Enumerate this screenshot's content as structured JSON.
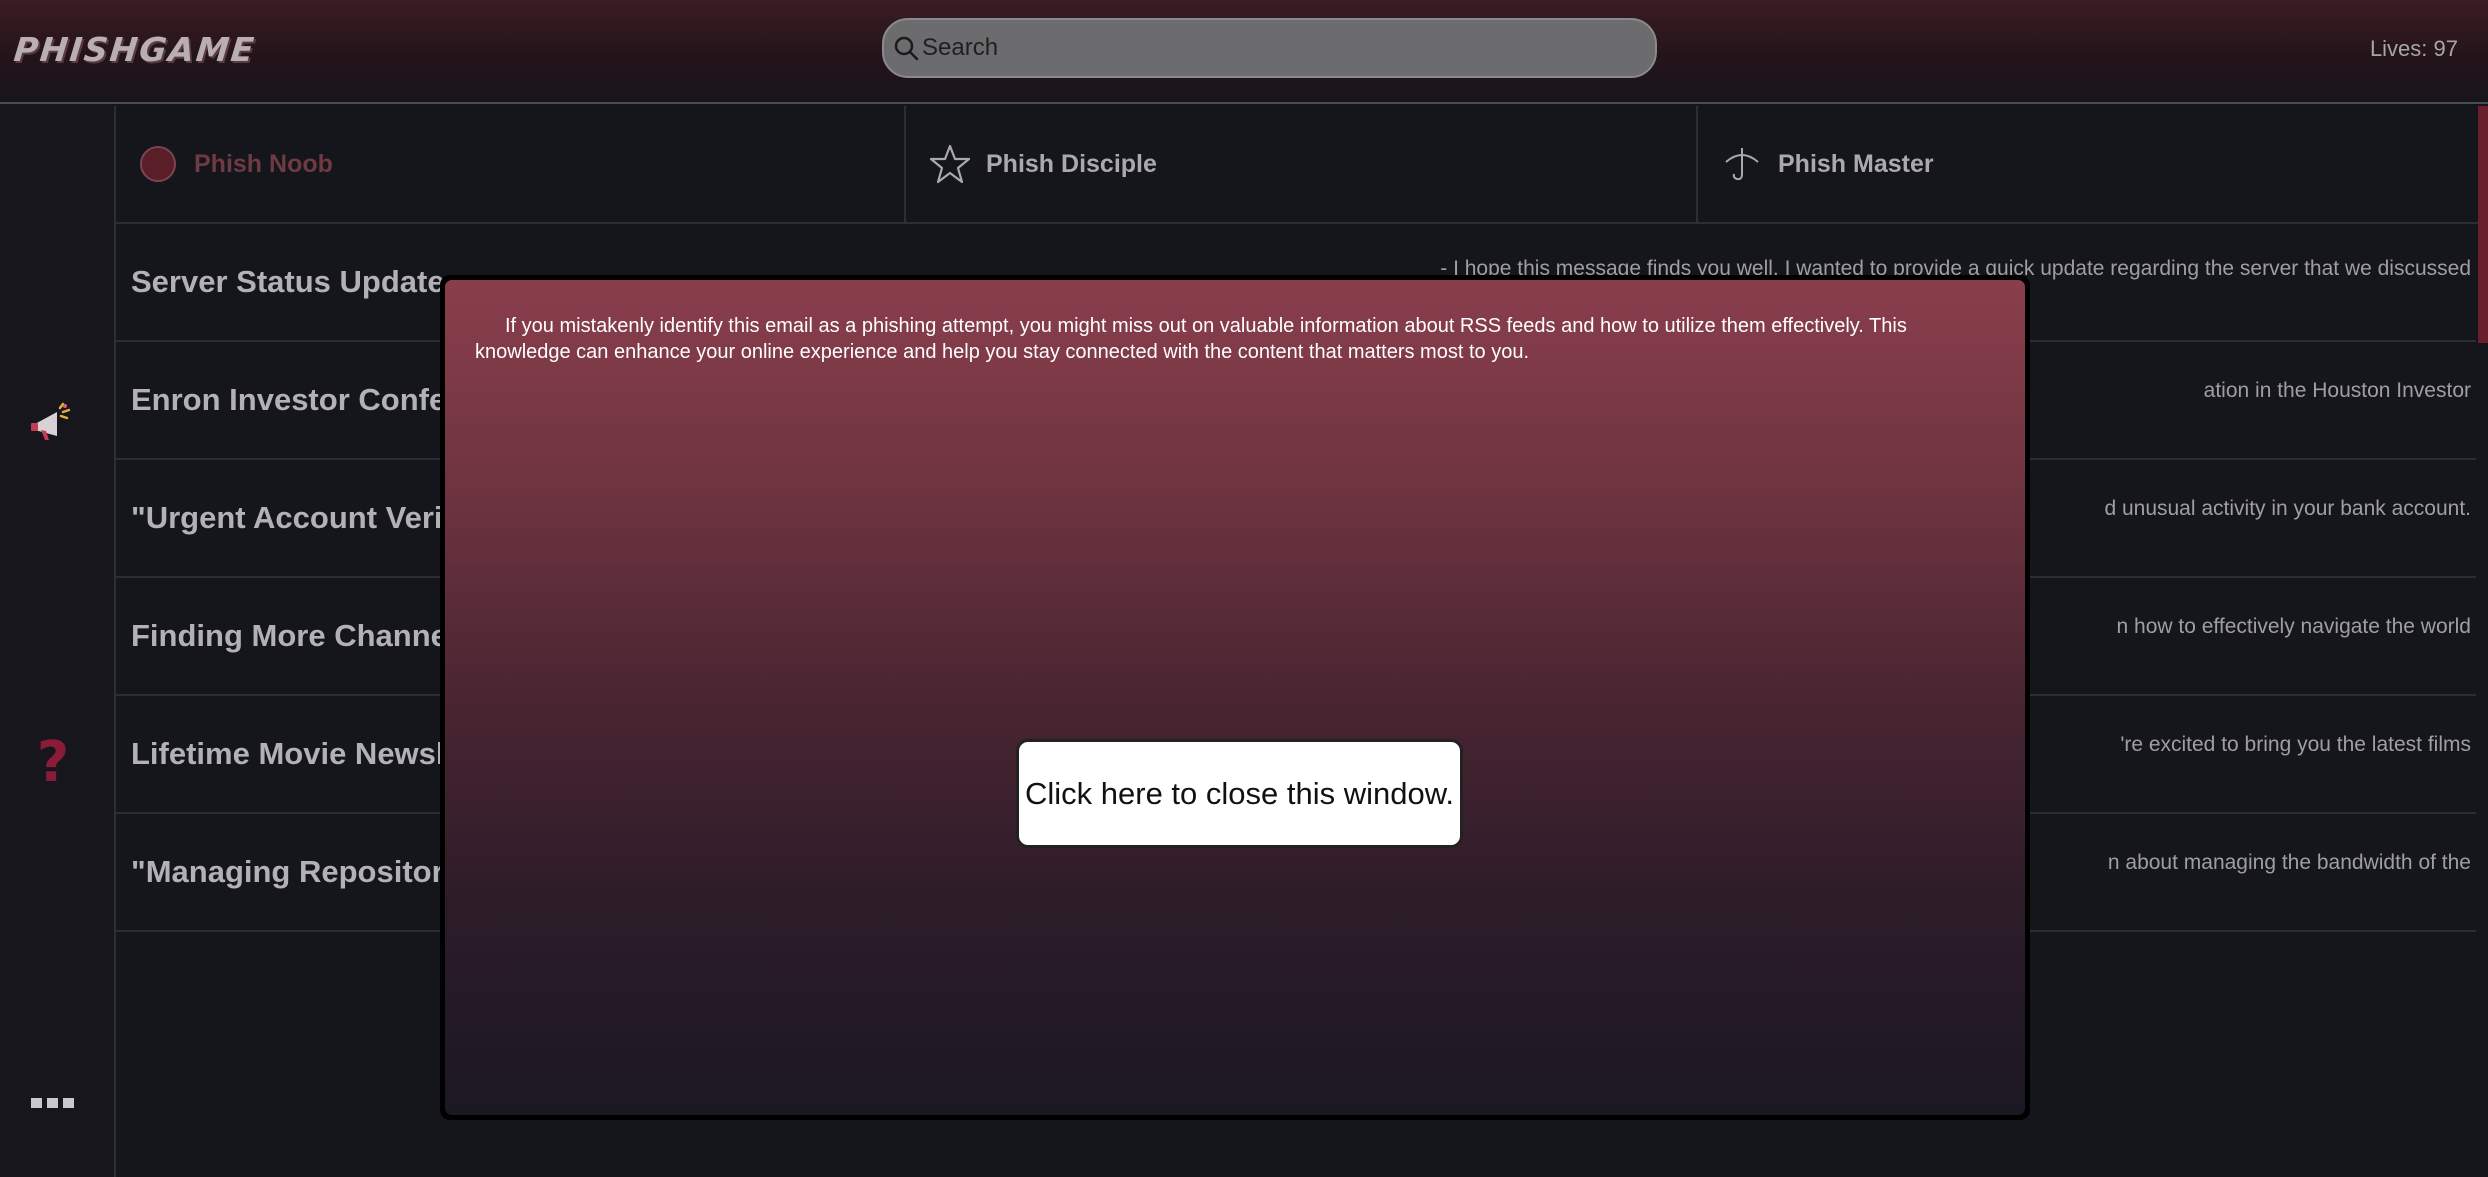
{
  "app": {
    "logo_text": "PHISHGAME",
    "lives_label": "Lives: 97"
  },
  "search": {
    "placeholder": "Search",
    "value": ""
  },
  "rail": {
    "icons": [
      "megaphone-icon",
      "question-mark-icon",
      "more-dots-icon"
    ]
  },
  "tabs": [
    {
      "label": "Phish Noob",
      "icon": "circle-icon",
      "active": true
    },
    {
      "label": "Phish Disciple",
      "icon": "star-icon",
      "active": false
    },
    {
      "label": "Phish Master",
      "icon": "fishhook-icon",
      "active": false
    }
  ],
  "emails": [
    {
      "subject": "Server Status Update",
      "preview": "- I hope this message finds you well. I wanted to provide a quick update regarding the server that we discussed"
    },
    {
      "subject": "Enron Investor Confer",
      "preview": "ation in the Houston Investor"
    },
    {
      "subject": "\"Urgent Account Verif",
      "preview": "d unusual activity in your bank account."
    },
    {
      "subject": "Finding More Channel",
      "preview": "n how to effectively navigate the world"
    },
    {
      "subject": "Lifetime Movie Newsle",
      "preview": "'re excited to bring you the latest films"
    },
    {
      "subject": "\"Managing Repository",
      "preview": "n about managing the bandwidth of the"
    }
  ],
  "modal": {
    "message": "If you mistakenly identify this email as a phishing attempt, you might miss out on valuable information about RSS feeds and how to utilize them effectively. This knowledge can enhance your online experience and help you stay connected with the content that matters most to you.",
    "close_label": "Click here to close this window."
  },
  "colors": {
    "accent": "#6e3a44",
    "modal_top": "#8a3e4c",
    "modal_bottom": "#1b1824",
    "rail_red_icon": "#8a1c3a"
  }
}
